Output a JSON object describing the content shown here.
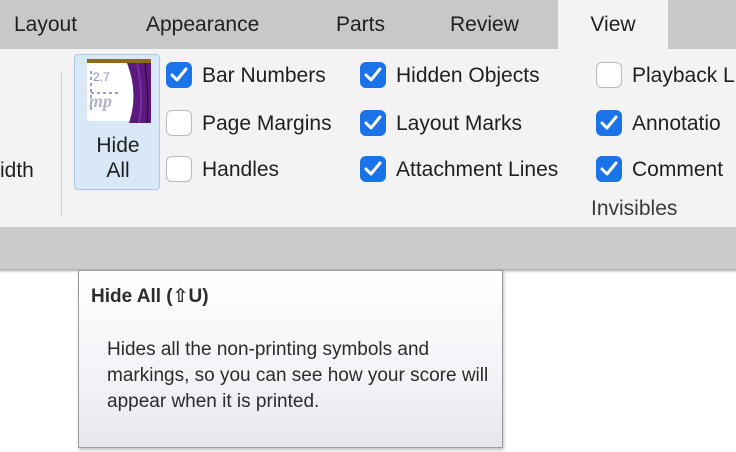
{
  "tabs": [
    {
      "label": "Layout",
      "active": false
    },
    {
      "label": "Appearance",
      "active": false
    },
    {
      "label": "Parts",
      "active": false
    },
    {
      "label": "Review",
      "active": false
    },
    {
      "label": "View",
      "active": true
    }
  ],
  "ribbon": {
    "left_partial_label": "idth",
    "hide_all": {
      "label_line1": "Hide",
      "label_line2": "All",
      "icon": "curtain-icon"
    },
    "checkboxes": [
      {
        "id": "bar-numbers",
        "label": "Bar Numbers",
        "checked": true
      },
      {
        "id": "page-margins",
        "label": "Page Margins",
        "checked": false
      },
      {
        "id": "handles",
        "label": "Handles",
        "checked": false
      },
      {
        "id": "hidden-objects",
        "label": "Hidden Objects",
        "checked": true
      },
      {
        "id": "layout-marks",
        "label": "Layout Marks",
        "checked": true
      },
      {
        "id": "attachment-lines",
        "label": "Attachment Lines",
        "checked": true
      },
      {
        "id": "playback-lines",
        "label": "Playback L",
        "checked": false
      },
      {
        "id": "annotations",
        "label": "Annotatio",
        "checked": true
      },
      {
        "id": "comments",
        "label": "Comment",
        "checked": true
      }
    ],
    "group_label": "Invisibles"
  },
  "tooltip": {
    "title": "Hide All (⇧U)",
    "body": "Hides all the non-printing symbols and markings, so you can see how your score will appear when it is printed."
  },
  "colors": {
    "accent": "#1a73e8",
    "tabbar": "#c8c8c8",
    "ribbon": "#f3f3f3",
    "button_highlight": "#d8e8f6"
  }
}
